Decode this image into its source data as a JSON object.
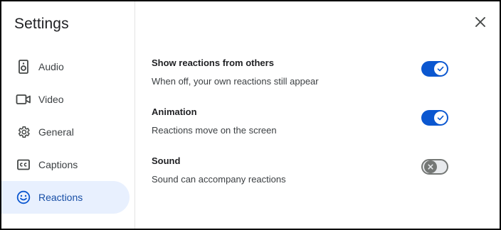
{
  "sidebar": {
    "title": "Settings",
    "items": [
      {
        "label": "Audio",
        "icon": "speaker-icon"
      },
      {
        "label": "Video",
        "icon": "video-camera-icon"
      },
      {
        "label": "General",
        "icon": "gear-icon"
      },
      {
        "label": "Captions",
        "icon": "closed-captions-icon"
      },
      {
        "label": "Reactions",
        "icon": "smiley-icon",
        "active": true
      }
    ]
  },
  "main": {
    "settings": [
      {
        "title": "Show reactions from others",
        "description": "When off, your own reactions still appear",
        "enabled": true
      },
      {
        "title": "Animation",
        "description": "Reactions move on the screen",
        "enabled": true
      },
      {
        "title": "Sound",
        "description": "Sound can accompany reactions",
        "enabled": false
      }
    ]
  },
  "colors": {
    "accent": "#0b57d0",
    "active_nav_bg": "#e8f0fe",
    "active_nav_text": "#174ea6",
    "toggle_off": "#747775"
  }
}
